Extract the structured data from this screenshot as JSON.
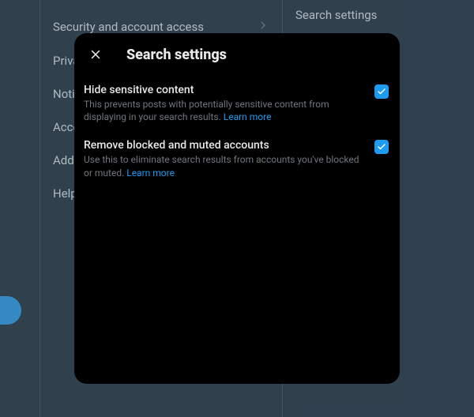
{
  "sidebar": {
    "items": [
      {
        "label": "Security and account access"
      },
      {
        "label": "Privacy and safety"
      },
      {
        "label": "Notifications"
      },
      {
        "label": "Accessibility, display, and languages"
      },
      {
        "label": "Additional resources"
      },
      {
        "label": "Help Center"
      }
    ]
  },
  "detail": {
    "title": "Search settings"
  },
  "modal": {
    "title": "Search settings",
    "options": [
      {
        "title": "Hide sensitive content",
        "desc": "This prevents posts with potentially sensitive content from displaying in your search results.",
        "learn_more": "Learn more",
        "checked": true
      },
      {
        "title": "Remove blocked and muted accounts",
        "desc": "Use this to eliminate search results from accounts you've blocked or muted.",
        "learn_more": "Learn more",
        "checked": true
      }
    ]
  },
  "colors": {
    "accent": "#1d9bf0",
    "bg": "#15202b",
    "modal_bg": "#000000"
  }
}
